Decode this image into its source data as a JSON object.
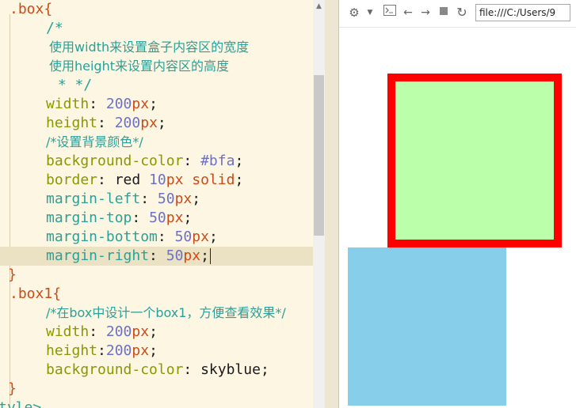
{
  "editor": {
    "lines": [
      {
        "sel": ".box",
        "brace": "{"
      },
      {
        "comment": "/*"
      },
      {
        "comment_cn": "使用width来设置盒子内容区的宽度"
      },
      {
        "comment_cn": "使用height来设置内容区的高度"
      },
      {
        "comment": " * */"
      },
      {
        "prop": "width",
        "num": "200",
        "unit": "px"
      },
      {
        "prop": "height",
        "num": "200",
        "unit": "px"
      },
      {
        "comment_cn": "/*设置背景颜色*/"
      },
      {
        "prop": "background-color",
        "value": "#bfa"
      },
      {
        "prop": "border",
        "v1": "red",
        "v2": "10",
        "v3": "px",
        "v4": "solid"
      },
      {
        "prop": "margin-left",
        "num": "50",
        "unit": "px"
      },
      {
        "prop": "margin-top",
        "num": "50",
        "unit": "px"
      },
      {
        "prop": "margin-bottom",
        "num": "50",
        "unit": "px"
      },
      {
        "prop": "margin-right",
        "num": "50",
        "unit": "px"
      },
      {
        "brace": "}"
      },
      {
        "sel": ".box1",
        "brace": "{"
      },
      {
        "comment_cn": "/*在box中设计一个box1，方便查看效果*/"
      },
      {
        "prop": "width",
        "num": "200",
        "unit": "px"
      },
      {
        "prop": "height",
        "num": "200",
        "unit": "px"
      },
      {
        "prop": "background-color",
        "value": "skyblue"
      },
      {
        "brace": "}"
      },
      {
        "partial": "tyle>"
      }
    ]
  },
  "preview": {
    "url": "file:///C:/Users/9",
    "icons": [
      "gear-icon",
      "dropdown-arrow-icon",
      "console-icon",
      "back-arrow-icon",
      "forward-arrow-icon",
      "stop-icon",
      "refresh-icon"
    ],
    "box_color": "#bbffaa",
    "box_border_color": "#ff0000",
    "box1_color": "#87ceeb"
  }
}
